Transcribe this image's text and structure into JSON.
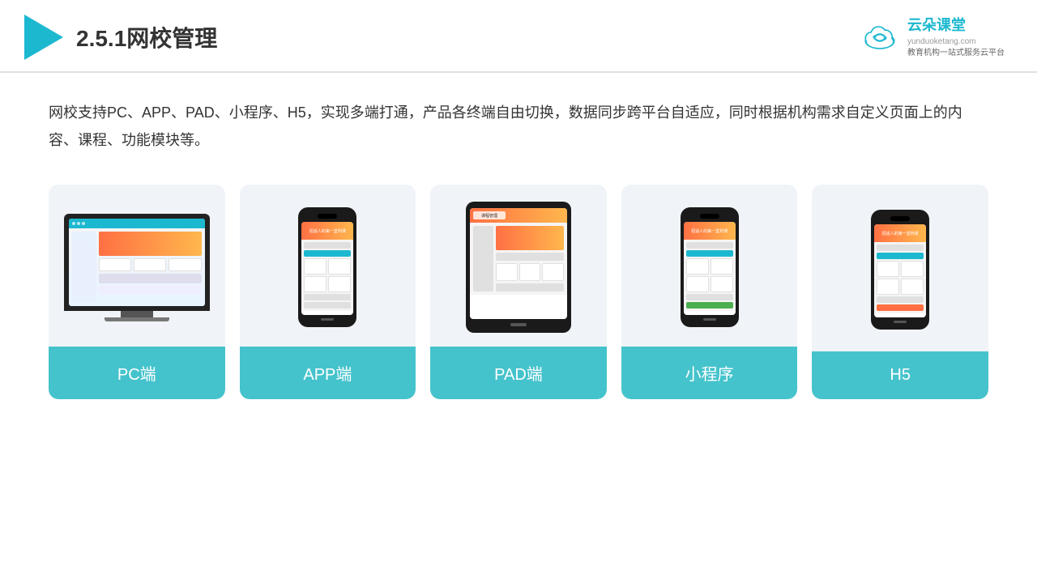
{
  "header": {
    "title": "2.5.1网校管理",
    "brand": {
      "name": "云朵课堂",
      "domain": "yunduoketang.com",
      "tagline": "教育机构一站\n式服务云平台"
    }
  },
  "description": "网校支持PC、APP、PAD、小程序、H5，实现多端打通，产品各终端自由切换，数据同步跨平台自适应，同时根据机构需求自定义页面上的内容、课程、功能模块等。",
  "cards": [
    {
      "id": "pc",
      "label": "PC端"
    },
    {
      "id": "app",
      "label": "APP端"
    },
    {
      "id": "pad",
      "label": "PAD端"
    },
    {
      "id": "miniprogram",
      "label": "小程序"
    },
    {
      "id": "h5",
      "label": "H5"
    }
  ],
  "colors": {
    "accent": "#1cb8d0",
    "card_bg": "#f0f4f8",
    "label_bg": "#45c3cc"
  }
}
